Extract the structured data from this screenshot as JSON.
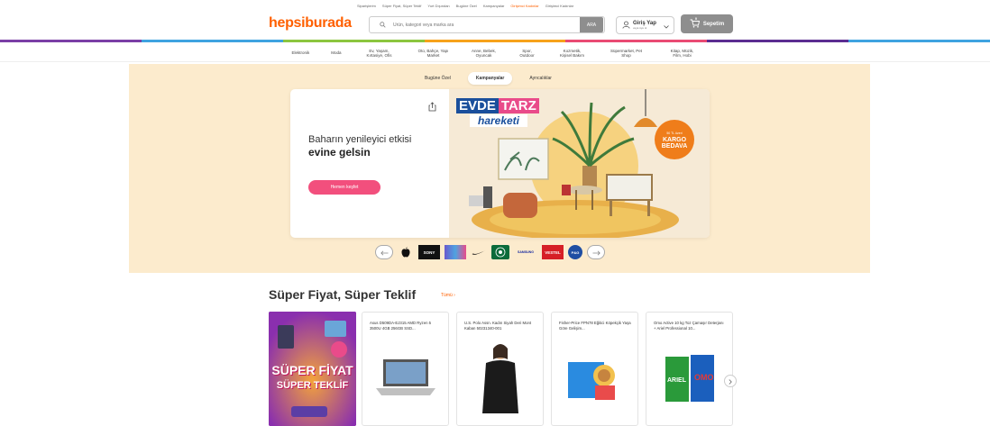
{
  "top_links": [
    {
      "label": "Siparişlerim",
      "highlight": false
    },
    {
      "label": "Süper Fiyat, Süper Teklif",
      "highlight": false
    },
    {
      "label": "Yurt Dışından",
      "highlight": false
    },
    {
      "label": "Bugüne Özel",
      "highlight": false
    },
    {
      "label": "Kampanyalar",
      "highlight": false
    },
    {
      "label": "Girişimci Kadınlar",
      "highlight": true
    },
    {
      "label": "Girişimci Kadınlar",
      "highlight": false
    }
  ],
  "header": {
    "logo": "hepsiburada",
    "search_placeholder": "Ürün, kategori veya marka ara",
    "search_button": "ARA",
    "login_title": "Giriş Yap",
    "login_subtitle": "veya üye ol",
    "cart_label": "Sepetim",
    "cart_count": "0"
  },
  "stripe_colors": [
    "#7b3fa6",
    "#3fa3e0",
    "#8cc63f",
    "#f7a21b",
    "#e94b73",
    "#5c2d91",
    "#3fa3e0"
  ],
  "categories": [
    "Elektronik",
    "Moda",
    "Ev, Yaşam, Kırtasiye, Ofis",
    "Oto, Bahçe, Yapı Market",
    "Anne, Bebek, Oyuncak",
    "Spor, Outdoor",
    "Kozmetik, Kişisel Bakım",
    "Süpermarket, Pet Shop",
    "Kitap, Müzik, Film, Hobi"
  ],
  "banner": {
    "tabs": [
      {
        "label": "Bugüne Özel",
        "active": false
      },
      {
        "label": "Kampanyalar",
        "active": true
      },
      {
        "label": "Ayrıcalıklar",
        "active": false
      }
    ],
    "headline_line1": "Baharın yenileyici etkisi",
    "headline_line2": "evine gelsin",
    "cta": "Hemen keşfet",
    "visual_title1": "EVDE",
    "visual_title2": "TARZ",
    "visual_title3": "hareketi",
    "badge_line1": "50 TL üzeri",
    "badge_line2": "KARGO",
    "badge_line3": "BEDAVA"
  },
  "brands": [
    "SONY",
    "SONY",
    "SAMSUNG",
    "VESTEL",
    "P&G"
  ],
  "section": {
    "title": "Süper Fiyat, Süper Teklif",
    "see_all": "Tümü ›",
    "promo_line1": "SÜPER FİYAT",
    "promo_line2": "SÜPER TEKLİF",
    "products": [
      {
        "title": "Asus D509DA-EJ315 AMD Ryzen 5 3500U 4GB 256GB SSD..."
      },
      {
        "title": "U.S. Polo Assn. Kadın Siyah Deri Mont Kaban 50231340-001"
      },
      {
        "title": "Fisher-Price FPN78 Eğitici Köpekçik Yaşa Göre Gelişim..."
      },
      {
        "title": "Omo Active 10 kg Toz Çamaşır Deterjanı + Ariel Professional 10..."
      }
    ]
  }
}
